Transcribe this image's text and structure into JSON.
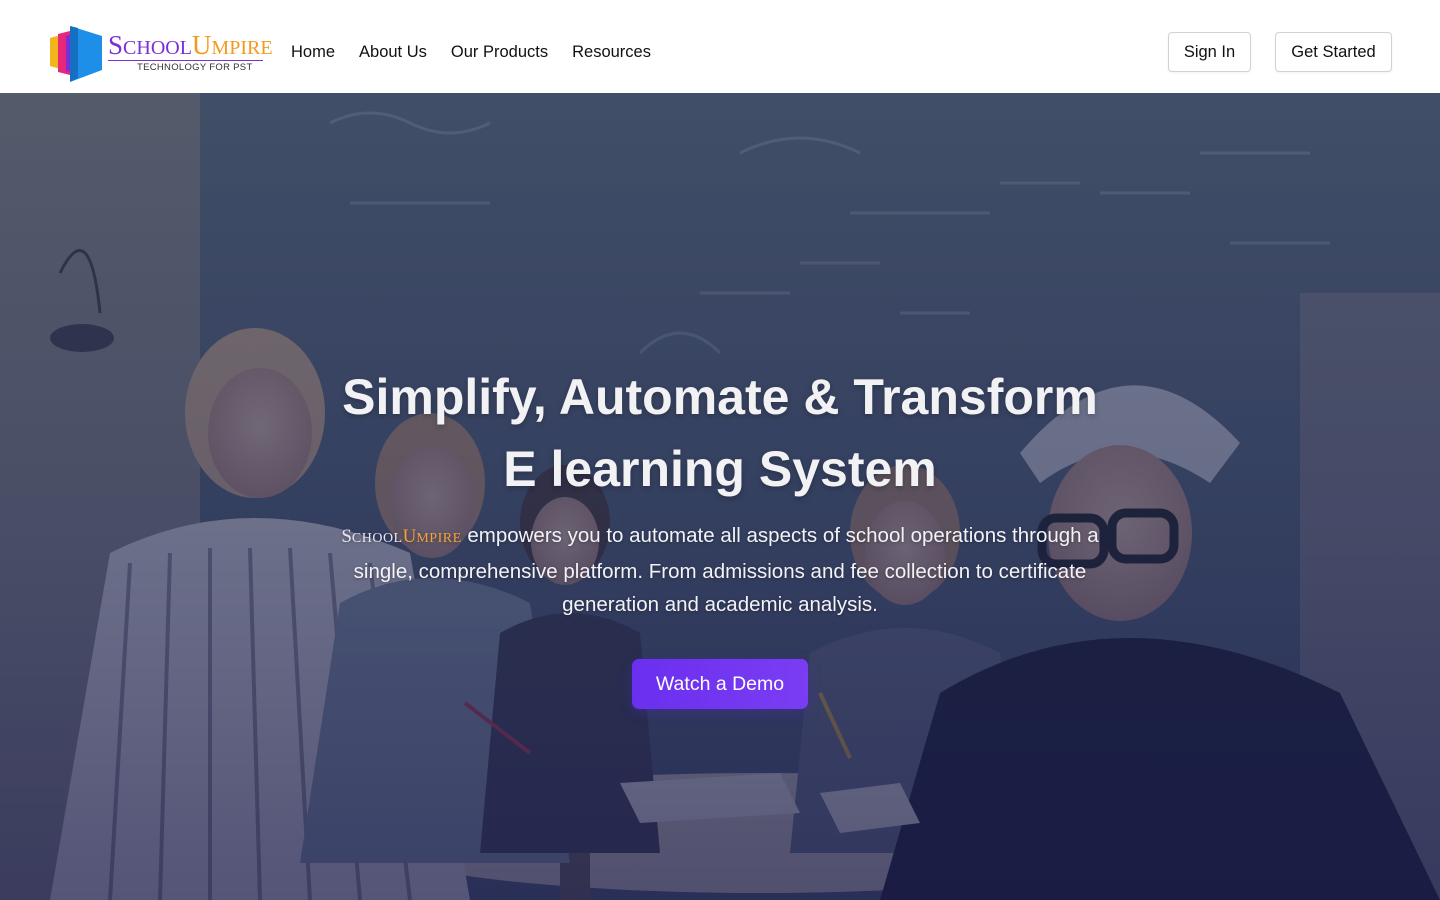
{
  "brand": {
    "name_school_first": "S",
    "name_school_rest": "CHOOL",
    "name_umpire_first": "U",
    "name_umpire_rest": "MPIRE",
    "tagline": "TECHNOLOGY FOR PST",
    "colors": {
      "school": "#7b2fd6",
      "umpire": "#f39a1e",
      "mark_blue": "#1e8fe8",
      "mark_pink": "#e6277a",
      "mark_yellow": "#f2b51c",
      "mark_purple": "#7b2fd6"
    }
  },
  "nav": {
    "items": [
      {
        "label": "Home"
      },
      {
        "label": "About Us"
      },
      {
        "label": "Our Products"
      },
      {
        "label": "Resources"
      }
    ]
  },
  "header_actions": {
    "sign_in": "Sign In",
    "get_started": "Get Started"
  },
  "hero": {
    "title_line1": "Simplify, Automate & Transform",
    "title_line2": "E learning System",
    "brand_inline": {
      "s": "S",
      "chool": "CHOOL",
      "u": "U",
      "mpire": "MPIRE"
    },
    "description": " empowers you to automate all aspects of school operations through a single, comprehensive platform. From admissions and fee collection to certificate generation and academic analysis.",
    "cta_label": "Watch a Demo",
    "colors": {
      "cta": "#6a2ff0",
      "overlay": "#283454"
    }
  }
}
